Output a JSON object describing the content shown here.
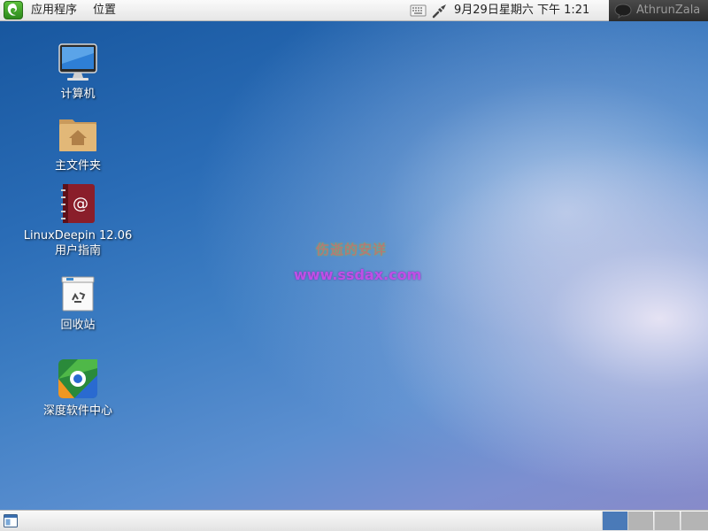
{
  "top_panel": {
    "menu_apps": "应用程序",
    "menu_places": "位置",
    "keyboard_icon": "keyboard-icon",
    "network_icon": "network-icon",
    "clock": "9月29日星期六 下午  1:21",
    "username": "AthrunZala",
    "logo_color": "#3aa02a"
  },
  "desktop": {
    "icons": [
      {
        "label": "计算机",
        "icon": "computer-icon"
      },
      {
        "label": "主文件夹",
        "icon": "home-folder-icon"
      },
      {
        "label_line1": "LinuxDeepin 12.06",
        "label_line2": "用户指南",
        "icon": "user-guide-icon"
      },
      {
        "label": "回收站",
        "icon": "trash-icon"
      },
      {
        "label": "深度软件中心",
        "icon": "software-center-icon"
      }
    ],
    "watermark_title": "伤逝的安详",
    "watermark_url": "www.ssdax.com"
  },
  "bottom_panel": {
    "show_desktop_icon": "show-desktop-icon",
    "workspaces": [
      {
        "name": "workspace-1",
        "active": true
      },
      {
        "name": "workspace-2",
        "active": false
      },
      {
        "name": "workspace-3",
        "active": false
      },
      {
        "name": "workspace-4",
        "active": false
      }
    ],
    "active_color": "#4a7ab8"
  }
}
